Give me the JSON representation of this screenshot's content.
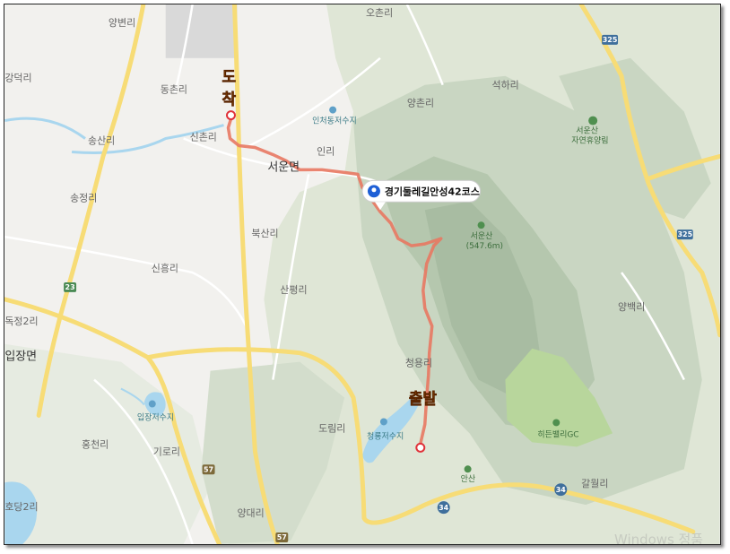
{
  "route": {
    "title": "경기둘레길안성42코스",
    "start_label": "출발",
    "end_label": "도착",
    "color": "#e87862"
  },
  "mountain": {
    "name": "서운산",
    "elevation": "(547.6m)"
  },
  "places": {
    "yangbyeonri": "양변리",
    "ochonri": "오촌리",
    "gangdeokri": "강덕리",
    "dongchonri": "동촌리",
    "yangchonri": "양촌리",
    "seokhari": "석하리",
    "songsanri": "송산리",
    "sinchonri": "신촌리",
    "inri": "인리",
    "seoun_myeon": "서운면",
    "songjeongri": "송정리",
    "buksanri": "북산리",
    "sinheungri": "신흥리",
    "sanpyeongri": "산평리",
    "dokjeong2ri": "독정2리",
    "yangbaekri": "양백리",
    "ipjang_myeon": "입장면",
    "cheongyongri": "청용리",
    "hongcheonri": "홍천리",
    "dorimri": "도림리",
    "girori": "기로리",
    "galwolri": "갈월리",
    "hodang2ri": "호당2리",
    "yangdaeri": "양대리"
  },
  "pois": {
    "reservoir_incheodong": "인처동저수지",
    "recreation_forest": "서운산\n자연휴양림",
    "reservoir_ipjang": "입장저수지",
    "reservoir_cheongyong": "청룡저수지",
    "hidden_valley_gc": "히든밸리GC",
    "ansan": "안산"
  },
  "roads": {
    "r325a": "325",
    "r325b": "325",
    "r23": "23",
    "r57a": "57",
    "r57b": "57",
    "r34a": "34",
    "r34b": "34"
  },
  "watermark": "Windows 정품",
  "colors": {
    "land": "#f2f1ee",
    "forest_light": "#dfe6d6",
    "forest_mid": "#c9d6c2",
    "forest_dark": "#a8bca2",
    "water": "#a9d6ee",
    "road_major": "#f7dc76",
    "road_minor": "#ffffff",
    "urban": "#d9d9d9",
    "golf": "#b8d69c"
  }
}
